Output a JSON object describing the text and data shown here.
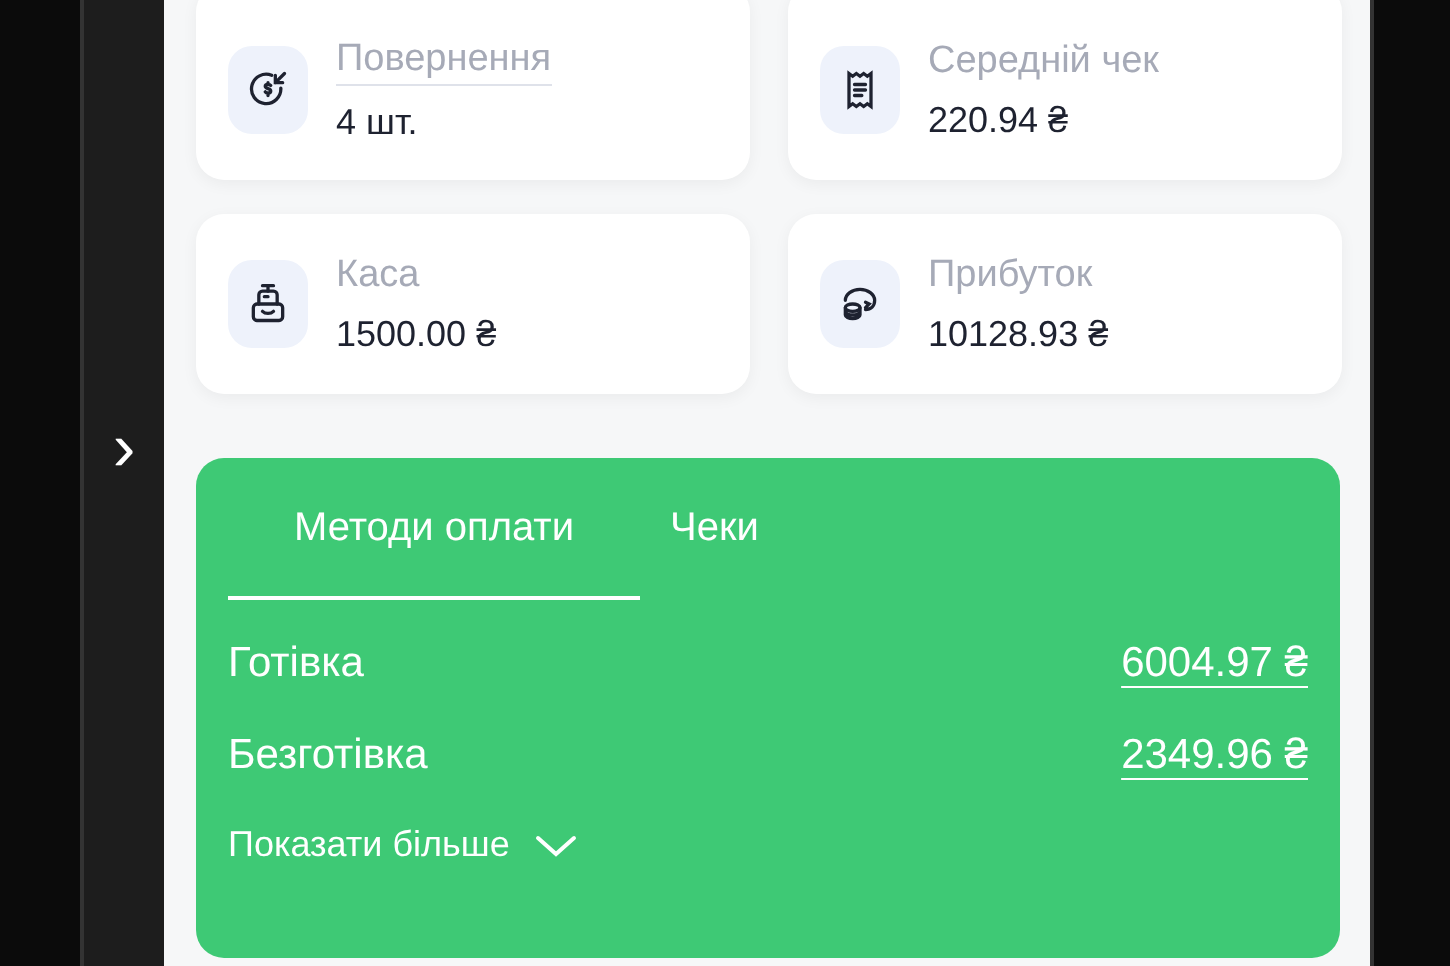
{
  "side_handle": {
    "glyph": "›"
  },
  "stats": [
    {
      "kind": "refund",
      "label": "Повернення",
      "value": "4 шт.",
      "linked": true
    },
    {
      "kind": "receipt",
      "label": "Середній чек",
      "value": "220.94 ₴",
      "linked": false
    },
    {
      "kind": "register",
      "label": "Каса",
      "value": "1500.00 ₴",
      "linked": false
    },
    {
      "kind": "coins",
      "label": "Прибуток",
      "value": "10128.93 ₴",
      "linked": false
    }
  ],
  "payments": {
    "tabs": [
      {
        "label": "Методи оплати",
        "selected": true
      },
      {
        "label": "Чеки",
        "selected": false
      }
    ],
    "rows": [
      {
        "label": "Готівка",
        "amount": "6004.97 ₴"
      },
      {
        "label": "Безготівка",
        "amount": "2349.96 ₴"
      }
    ],
    "more": "Показати більше"
  }
}
